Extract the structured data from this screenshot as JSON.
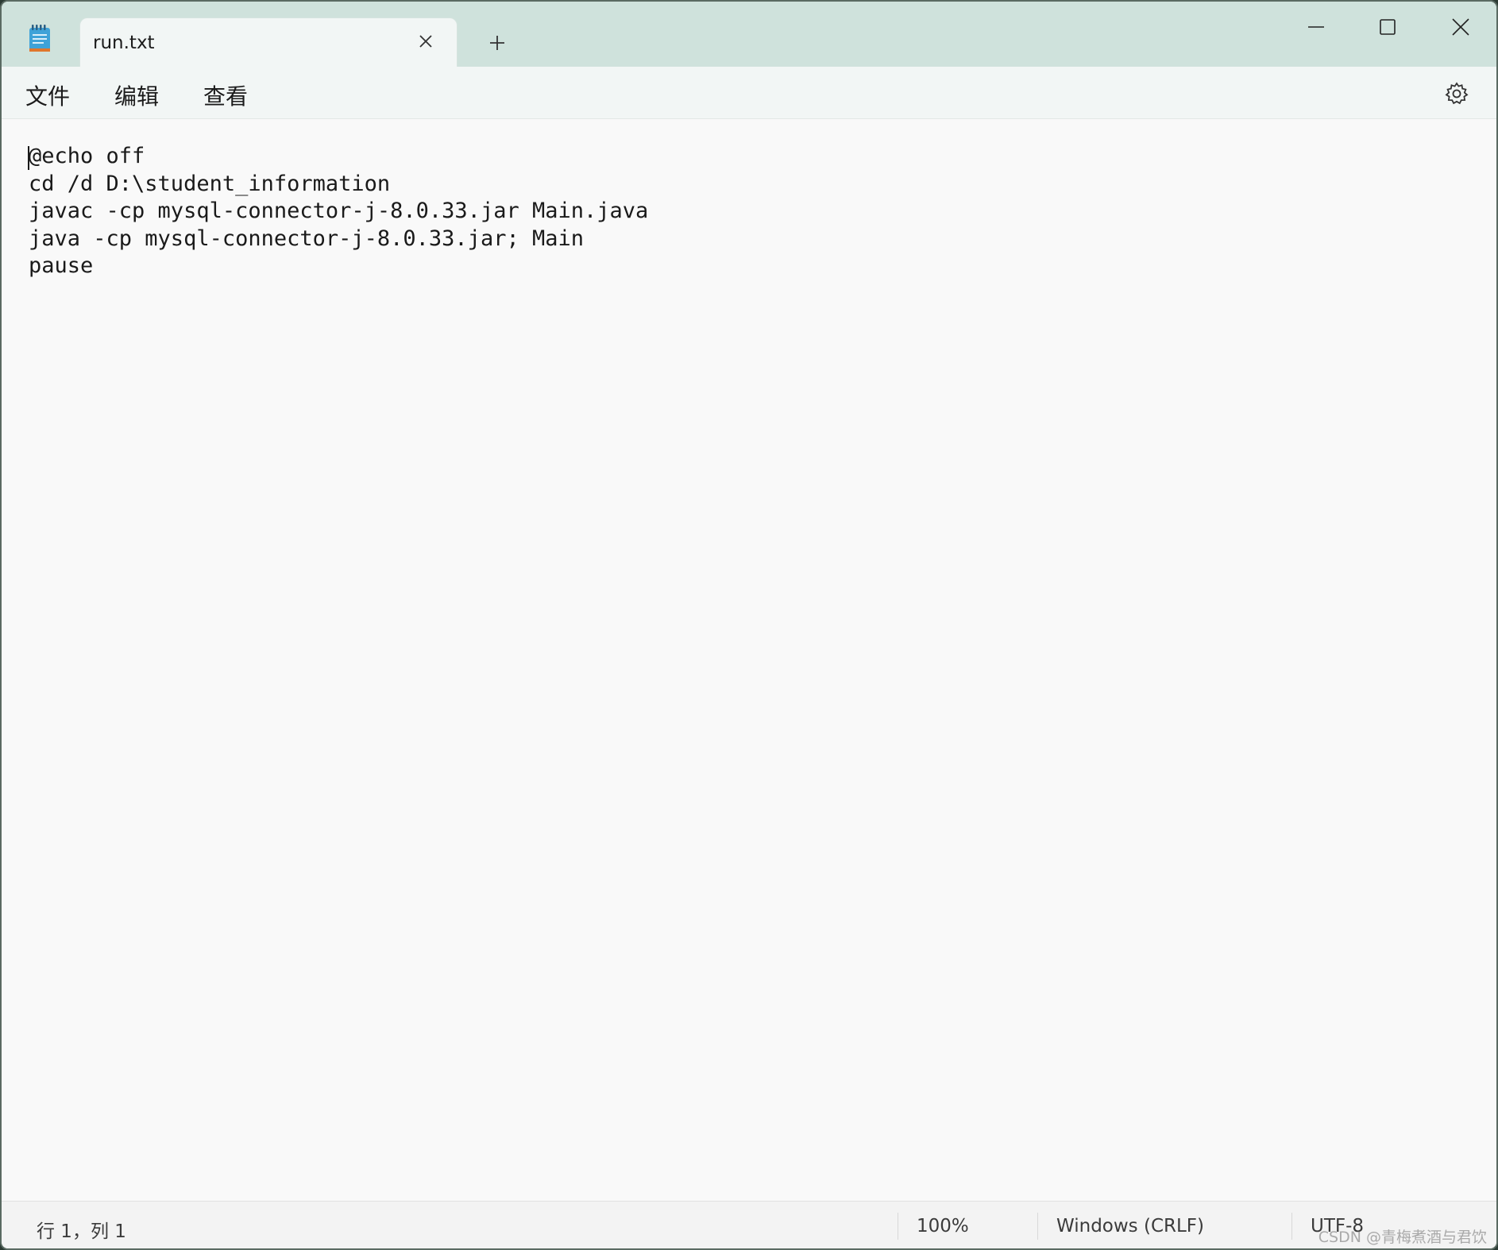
{
  "tab": {
    "title": "run.txt"
  },
  "menu": {
    "file": "文件",
    "edit": "编辑",
    "view": "查看"
  },
  "editor": {
    "content": "@echo off\ncd /d D:\\student_information\njavac -cp mysql-connector-j-8.0.33.jar Main.java\njava -cp mysql-connector-j-8.0.33.jar; Main\npause"
  },
  "status": {
    "position": "行 1，列 1",
    "zoom": "100%",
    "line_ending": "Windows (CRLF)",
    "encoding": "UTF-8"
  },
  "watermark": "CSDN @青梅煮酒与君饮",
  "icons": {
    "app": "notepad-icon",
    "tab_close": "close-icon",
    "new_tab": "plus-icon",
    "minimize": "minimize-icon",
    "maximize": "maximize-icon",
    "close": "close-icon",
    "settings": "gear-icon"
  }
}
